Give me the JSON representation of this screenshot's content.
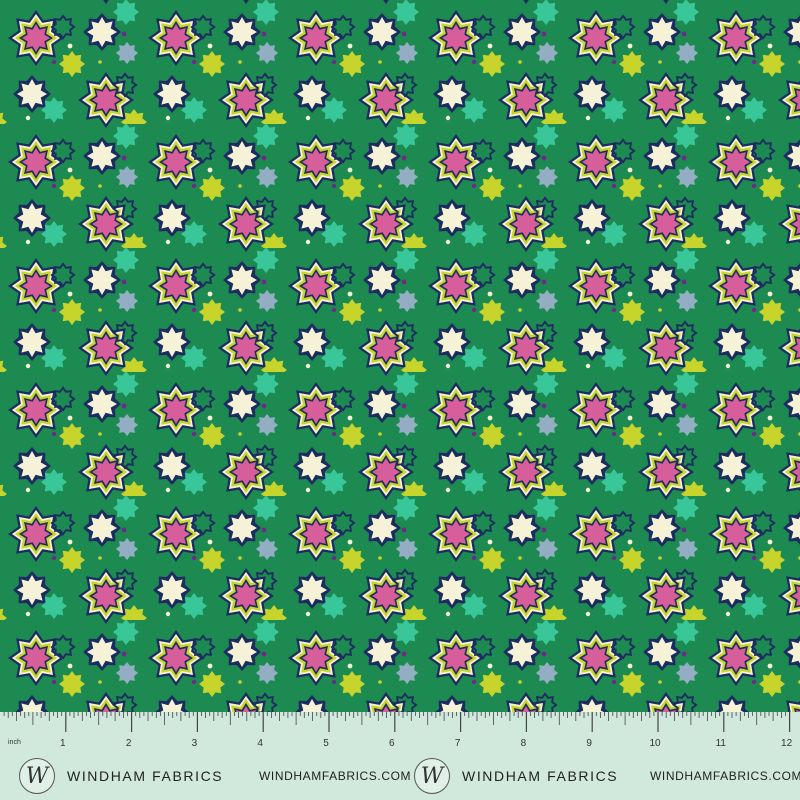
{
  "ruler": {
    "unit_label": "inch",
    "numbers": [
      "1",
      "2",
      "3",
      "4",
      "5",
      "6",
      "7",
      "8",
      "9",
      "10",
      "11",
      "12"
    ]
  },
  "brand": {
    "name": "WINDHAM FABRICS",
    "url": "WINDHAMFABRICS.COM",
    "logo_letter": "W"
  },
  "colors": {
    "background": "#1d8a52",
    "navy": "#1b2d5e",
    "cream": "#f6f2d8",
    "lime": "#c6d42c",
    "pink": "#d75e9a",
    "teal": "#39c79a",
    "slate": "#93aec2",
    "purple": "#6b2b87"
  }
}
